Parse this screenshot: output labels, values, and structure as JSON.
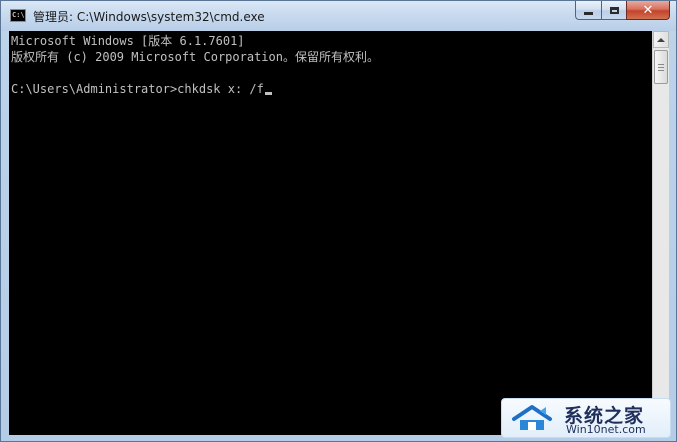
{
  "window": {
    "title": "管理员: C:\\Windows\\system32\\cmd.exe",
    "icon": "cmd-icon",
    "icon_text": "C:\\."
  },
  "caption_buttons": {
    "minimize_icon": "minimize-icon",
    "maximize_icon": "maximize-icon",
    "close_icon": "close-icon",
    "close_glyph": "✕"
  },
  "console": {
    "lines": [
      "Microsoft Windows [版本 6.1.7601]",
      "版权所有 (c) 2009 Microsoft Corporation。保留所有权利。",
      "",
      "C:\\Users\\Administrator>chkdsk x: /f"
    ],
    "text_color": "#c0c0c0",
    "background_color": "#000000"
  },
  "watermark": {
    "name_cn": "系统之家",
    "url": "Win10net.com"
  }
}
